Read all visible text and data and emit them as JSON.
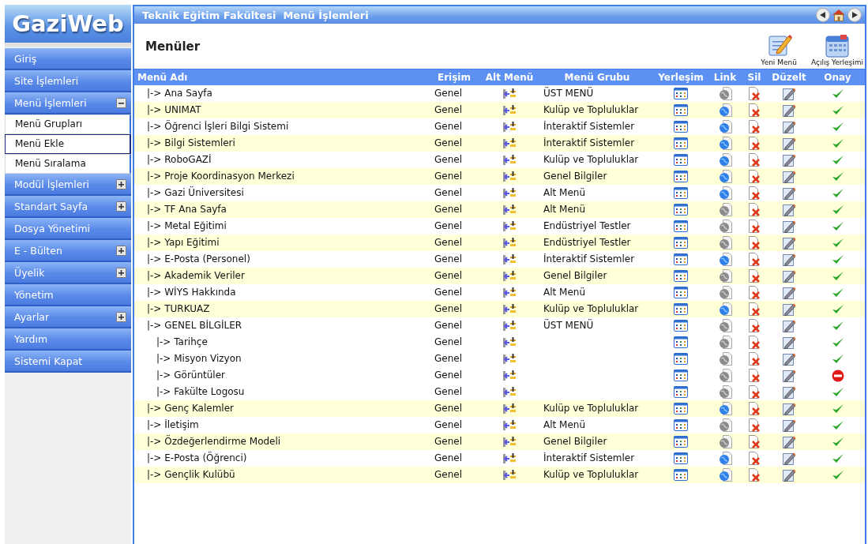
{
  "logo": {
    "text": "GaziWeb"
  },
  "sidebar": {
    "items": [
      {
        "label": "Giriş"
      },
      {
        "label": "Site İşlemleri"
      },
      {
        "label": "Menü İşlemleri",
        "expanded": true,
        "children": [
          {
            "label": "Menü Grupları",
            "selected": false
          },
          {
            "label": "Menü Ekle",
            "selected": true
          },
          {
            "label": "Menü Sıralama",
            "selected": false
          }
        ]
      },
      {
        "label": "Modül İşlemleri",
        "expanded": false
      },
      {
        "label": "Standart Sayfa",
        "expanded": false
      },
      {
        "label": "Dosya Yönetimi"
      },
      {
        "label": "E - Bülten",
        "expanded": false
      },
      {
        "label": "Üyelik",
        "expanded": false
      },
      {
        "label": "Yönetim"
      },
      {
        "label": "Ayarlar",
        "expanded": false
      },
      {
        "label": "Yardım"
      },
      {
        "label": "Sistemi Kapat"
      }
    ]
  },
  "window": {
    "title": "Teknik Eğitim Fakültesi  Menü İşlemleri"
  },
  "page": {
    "heading": "Menüler"
  },
  "toolbar": [
    {
      "kind": "new",
      "label": "Yeni Menü"
    },
    {
      "kind": "layout",
      "label": "Açılış Yerleşimi"
    }
  ],
  "table": {
    "columns": [
      "Menü Adı",
      "Erişim",
      "Alt Menü",
      "Menü Grubu",
      "Yerleşim",
      "Link",
      "Sil",
      "Düzelt",
      "Onay"
    ],
    "rows": [
      {
        "name": "|-> Ana Sayfa",
        "access": "Genel",
        "group": "ÜST MENÜ",
        "linked": false,
        "approved": true
      },
      {
        "name": "|-> UNIMAT",
        "access": "Genel",
        "group": "Kulüp ve Topluluklar",
        "linked": true,
        "approved": true
      },
      {
        "name": "|-> Öğrenci İşleri Bilgi Sistemi",
        "access": "Genel",
        "group": "İnteraktif Sistemler",
        "linked": true,
        "approved": true
      },
      {
        "name": "|-> Bilgi Sistemleri",
        "access": "Genel",
        "group": "İnteraktif Sistemler",
        "linked": true,
        "approved": true
      },
      {
        "name": "|-> RoboGAZİ",
        "access": "Genel",
        "group": "Kulüp ve Topluluklar",
        "linked": true,
        "approved": true
      },
      {
        "name": "|-> Proje Koordinasyon Merkezi",
        "access": "Genel",
        "group": "Genel Bilgiler",
        "linked": true,
        "approved": true
      },
      {
        "name": "|-> Gazi Üniversitesi",
        "access": "Genel",
        "group": "Alt Menü",
        "linked": true,
        "approved": true
      },
      {
        "name": "|-> TF Ana Sayfa",
        "access": "Genel",
        "group": "Alt Menü",
        "linked": false,
        "approved": true
      },
      {
        "name": "|-> Metal Eğitimi",
        "access": "Genel",
        "group": "Endüstriyel Testler",
        "linked": false,
        "approved": true
      },
      {
        "name": "|-> Yapı Eğitimi",
        "access": "Genel",
        "group": "Endüstriyel Testler",
        "linked": false,
        "approved": true
      },
      {
        "name": "|-> E-Posta (Personel)",
        "access": "Genel",
        "group": "İnteraktif Sistemler",
        "linked": true,
        "approved": true
      },
      {
        "name": "|-> Akademik Veriler",
        "access": "Genel",
        "group": "Genel Bilgiler",
        "linked": false,
        "approved": true
      },
      {
        "name": "|-> WİYS Hakkında",
        "access": "Genel",
        "group": "Alt Menü",
        "linked": false,
        "approved": true
      },
      {
        "name": "|-> TURKUAZ",
        "access": "Genel",
        "group": "Kulüp ve Topluluklar",
        "linked": true,
        "approved": true
      },
      {
        "name": "|-> GENEL BİLGİLER",
        "access": "Genel",
        "group": "ÜST MENÜ",
        "linked": false,
        "approved": true,
        "children": [
          {
            "name": "|-> Tarihçe",
            "access": "Genel",
            "linked": false,
            "approved": true
          },
          {
            "name": "|-> Misyon Vizyon",
            "access": "Genel",
            "linked": false,
            "approved": true
          },
          {
            "name": "|-> Görüntüler",
            "access": "Genel",
            "linked": false,
            "approved": false
          },
          {
            "name": "|-> Fakülte Logosu",
            "access": "Genel",
            "linked": false,
            "approved": true
          }
        ]
      },
      {
        "name": "|-> Genç Kalemler",
        "access": "Genel",
        "group": "Kulüp ve Topluluklar",
        "linked": true,
        "approved": true
      },
      {
        "name": "|-> İletişim",
        "access": "Genel",
        "group": "Alt Menü",
        "linked": false,
        "approved": true
      },
      {
        "name": "|-> Özdeğerlendirme Modeli",
        "access": "Genel",
        "group": "Genel Bilgiler",
        "linked": false,
        "approved": true
      },
      {
        "name": "|-> E-Posta (Öğrenci)",
        "access": "Genel",
        "group": "İnteraktif Sistemler",
        "linked": true,
        "approved": true
      },
      {
        "name": "|-> Gençlik Kulübü",
        "access": "Genel",
        "group": "Kulüp ve Topluluklar",
        "linked": true,
        "approved": true
      }
    ]
  }
}
